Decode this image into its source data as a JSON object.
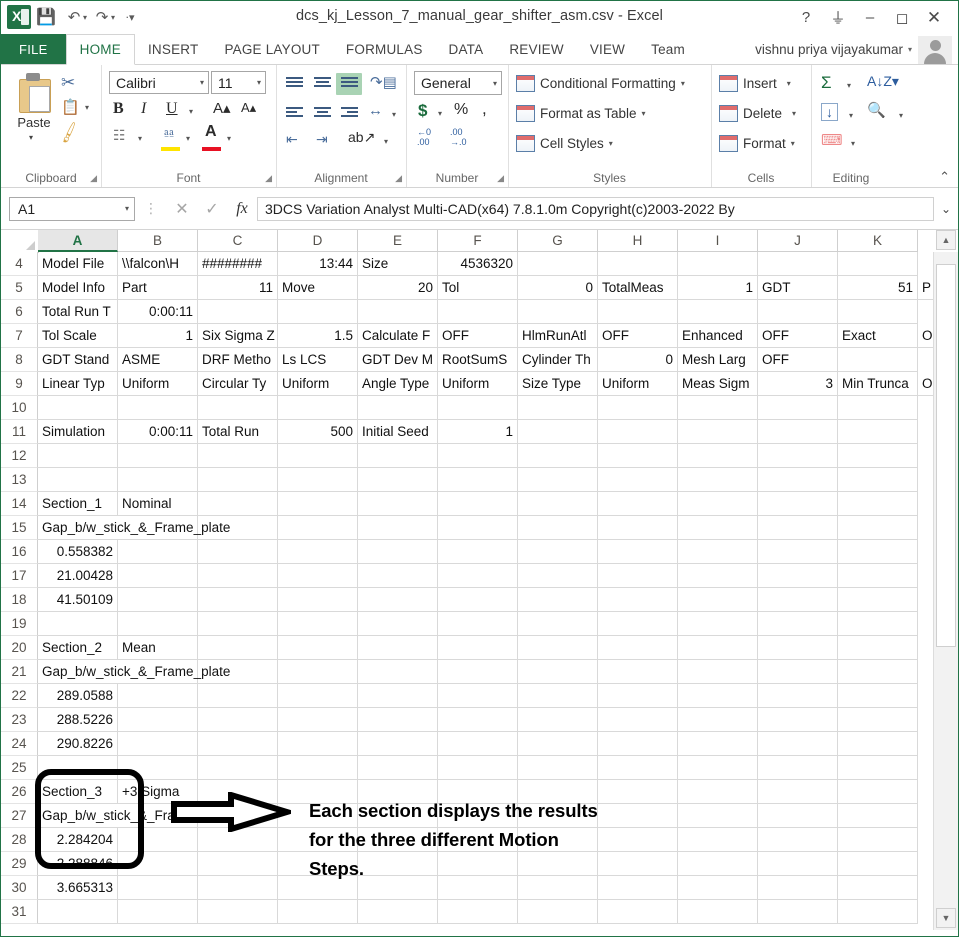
{
  "window": {
    "title": "dcs_kj_Lesson_7_manual_gear_shifter_asm.csv - Excel",
    "help_icon": "?",
    "ribbon_display_icon": "ribbon-display-options",
    "minimize_icon": "–",
    "restore_icon": "❑",
    "close_icon": "✕"
  },
  "quick_access": {
    "save_label": "save",
    "undo_label": "undo",
    "redo_label": "redo",
    "customize_label": "customize"
  },
  "tabs": [
    {
      "label": "FILE",
      "id": "file"
    },
    {
      "label": "HOME",
      "id": "home"
    },
    {
      "label": "INSERT",
      "id": "insert"
    },
    {
      "label": "PAGE LAYOUT",
      "id": "page-layout"
    },
    {
      "label": "FORMULAS",
      "id": "formulas"
    },
    {
      "label": "DATA",
      "id": "data"
    },
    {
      "label": "REVIEW",
      "id": "review"
    },
    {
      "label": "VIEW",
      "id": "view"
    },
    {
      "label": "Team",
      "id": "team"
    }
  ],
  "account": {
    "user_name": "vishnu priya vijayakumar",
    "caret": "▾"
  },
  "ribbon": {
    "groups": [
      {
        "name": "Clipboard"
      },
      {
        "name": "Font"
      },
      {
        "name": "Alignment"
      },
      {
        "name": "Number"
      },
      {
        "name": "Styles"
      },
      {
        "name": "Cells"
      },
      {
        "name": "Editing"
      }
    ],
    "clipboard": {
      "paste_label": "Paste",
      "cut_label": "Cut",
      "copy_label": "Copy",
      "format_painter_label": "Format Painter"
    },
    "font": {
      "font_name": "Calibri",
      "font_size": "11",
      "bold": "B",
      "italic": "I",
      "underline": "U",
      "grow_font": "A",
      "shrink_font": "A",
      "borders_label": "Borders",
      "fill_color_label": "Fill Color",
      "font_color_label": "Font Color"
    },
    "number": {
      "format": "General",
      "currency": "$",
      "percent": "%",
      "comma": ",",
      "increase_decimal": ".00",
      "decrease_decimal": ".00"
    },
    "styles": {
      "conditional_formatting": "Conditional Formatting",
      "format_as_table": "Format as Table",
      "cell_styles": "Cell Styles"
    },
    "cells": {
      "insert": "Insert",
      "delete": "Delete",
      "format": "Format"
    },
    "editing": {
      "autosum": "Σ",
      "fill": "↓",
      "clear": "Clear",
      "sort_filter": "Sort & Filter",
      "find_select": "Find & Select"
    },
    "collapse_icon": "⌃"
  },
  "formula_bar": {
    "name_box": "A1",
    "cancel_icon": "✕",
    "enter_icon": "✓",
    "function_icon": "fx",
    "value": "3DCS Variation Analyst Multi-CAD(x64) 7.8.1.0m Copyright(c)2003-2022 By",
    "expand_icon": "⌄"
  },
  "grid": {
    "columns": [
      "A",
      "B",
      "C",
      "D",
      "E",
      "F",
      "G",
      "H",
      "I",
      "J",
      "K"
    ],
    "selected_column": "A",
    "rows": [
      {
        "n": "4",
        "cells": {
          "A": "Model File",
          "B": "\\\\falcon\\H",
          "C": "########",
          "D": "13:44",
          "E": "Size",
          "F": "4536320"
        },
        "align": {
          "D": "r",
          "F": "r"
        }
      },
      {
        "n": "5",
        "cells": {
          "A": "Model Info",
          "B": "Part",
          "C": "11",
          "D": "Move",
          "E": "20",
          "F": "Tol",
          "G": "0",
          "H": "TotalMeas",
          "I": "1",
          "J": "GDT",
          "K": "51",
          "L": "P"
        },
        "align": {
          "C": "r",
          "E": "r",
          "G": "r",
          "I": "r",
          "K": "r"
        }
      },
      {
        "n": "6",
        "cells": {
          "A": "Total Run T",
          "B": "0:00:11"
        },
        "align": {
          "B": "r"
        }
      },
      {
        "n": "7",
        "cells": {
          "A": "Tol Scale",
          "B": "1",
          "C": "Six Sigma Z",
          "D": "1.5",
          "E": "Calculate F",
          "F": "OFF",
          "G": "HlmRunAtl",
          "H": "OFF",
          "I": "Enhanced",
          "J": "OFF",
          "K": "Exact",
          "L": "O"
        },
        "align": {
          "B": "r",
          "D": "r"
        }
      },
      {
        "n": "8",
        "cells": {
          "A": "GDT Stand",
          "B": "ASME",
          "C": "DRF Metho",
          "D": "Ls LCS",
          "E": "GDT Dev M",
          "F": "RootSumS",
          "G": "Cylinder Th",
          "H": "0",
          "I": "Mesh Larg",
          "J": "OFF"
        },
        "align": {
          "H": "r"
        }
      },
      {
        "n": "9",
        "cells": {
          "A": "Linear Typ",
          "B": "Uniform",
          "C": "Circular Ty",
          "D": "Uniform",
          "E": "Angle Type",
          "F": "Uniform",
          "G": "Size Type",
          "H": "Uniform",
          "I": "Meas Sigm",
          "J": "3",
          "K": "Min Trunca",
          "L": "O"
        },
        "align": {
          "J": "r"
        }
      },
      {
        "n": "10",
        "cells": {},
        "align": {}
      },
      {
        "n": "11",
        "cells": {
          "A": "Simulation",
          "B": "0:00:11",
          "C": "Total Run",
          "D": "500",
          "E": "Initial Seed",
          "F": "1"
        },
        "align": {
          "B": "r",
          "D": "r",
          "F": "r"
        }
      },
      {
        "n": "12",
        "cells": {},
        "align": {}
      },
      {
        "n": "13",
        "cells": {},
        "align": {}
      },
      {
        "n": "14",
        "cells": {
          "A": "Section_1",
          "B": "Nominal"
        },
        "align": {}
      },
      {
        "n": "15",
        "cells": {
          "A": "Gap_b/w_stick_&_Frame_plate"
        },
        "align": {},
        "spill": "A"
      },
      {
        "n": "16",
        "cells": {
          "A": "0.558382"
        },
        "align": {
          "A": "r"
        }
      },
      {
        "n": "17",
        "cells": {
          "A": "21.00428"
        },
        "align": {
          "A": "r"
        }
      },
      {
        "n": "18",
        "cells": {
          "A": "41.50109"
        },
        "align": {
          "A": "r"
        }
      },
      {
        "n": "19",
        "cells": {},
        "align": {}
      },
      {
        "n": "20",
        "cells": {
          "A": "Section_2",
          "B": "Mean"
        },
        "align": {}
      },
      {
        "n": "21",
        "cells": {
          "A": "Gap_b/w_stick_&_Frame_plate"
        },
        "align": {},
        "spill": "A"
      },
      {
        "n": "22",
        "cells": {
          "A": "289.0588"
        },
        "align": {
          "A": "r"
        }
      },
      {
        "n": "23",
        "cells": {
          "A": "288.5226"
        },
        "align": {
          "A": "r"
        }
      },
      {
        "n": "24",
        "cells": {
          "A": "290.8226"
        },
        "align": {
          "A": "r"
        }
      },
      {
        "n": "25",
        "cells": {},
        "align": {}
      },
      {
        "n": "26",
        "cells": {
          "A": "Section_3",
          "B": "+3 Sigma"
        },
        "align": {}
      },
      {
        "n": "27",
        "cells": {
          "A": "Gap_b/w_stick_&_Frame_plate"
        },
        "align": {},
        "spill": "A"
      },
      {
        "n": "28",
        "cells": {
          "A": "2.284204"
        },
        "align": {
          "A": "r"
        }
      },
      {
        "n": "29",
        "cells": {
          "A": "2.288846"
        },
        "align": {
          "A": "r"
        }
      },
      {
        "n": "30",
        "cells": {
          "A": "3.665313"
        },
        "align": {
          "A": "r"
        }
      },
      {
        "n": "31",
        "cells": {},
        "align": {}
      }
    ]
  },
  "annotations": {
    "callout_label": "highlight-box-rows-16-18",
    "arrow_label": "pointer-arrow",
    "note_line1": "Each section displays the results",
    "note_line2": "for the three different Motion",
    "note_line3": "Steps."
  },
  "scrollbar": {
    "up_icon": "▲",
    "down_icon": "▼"
  }
}
